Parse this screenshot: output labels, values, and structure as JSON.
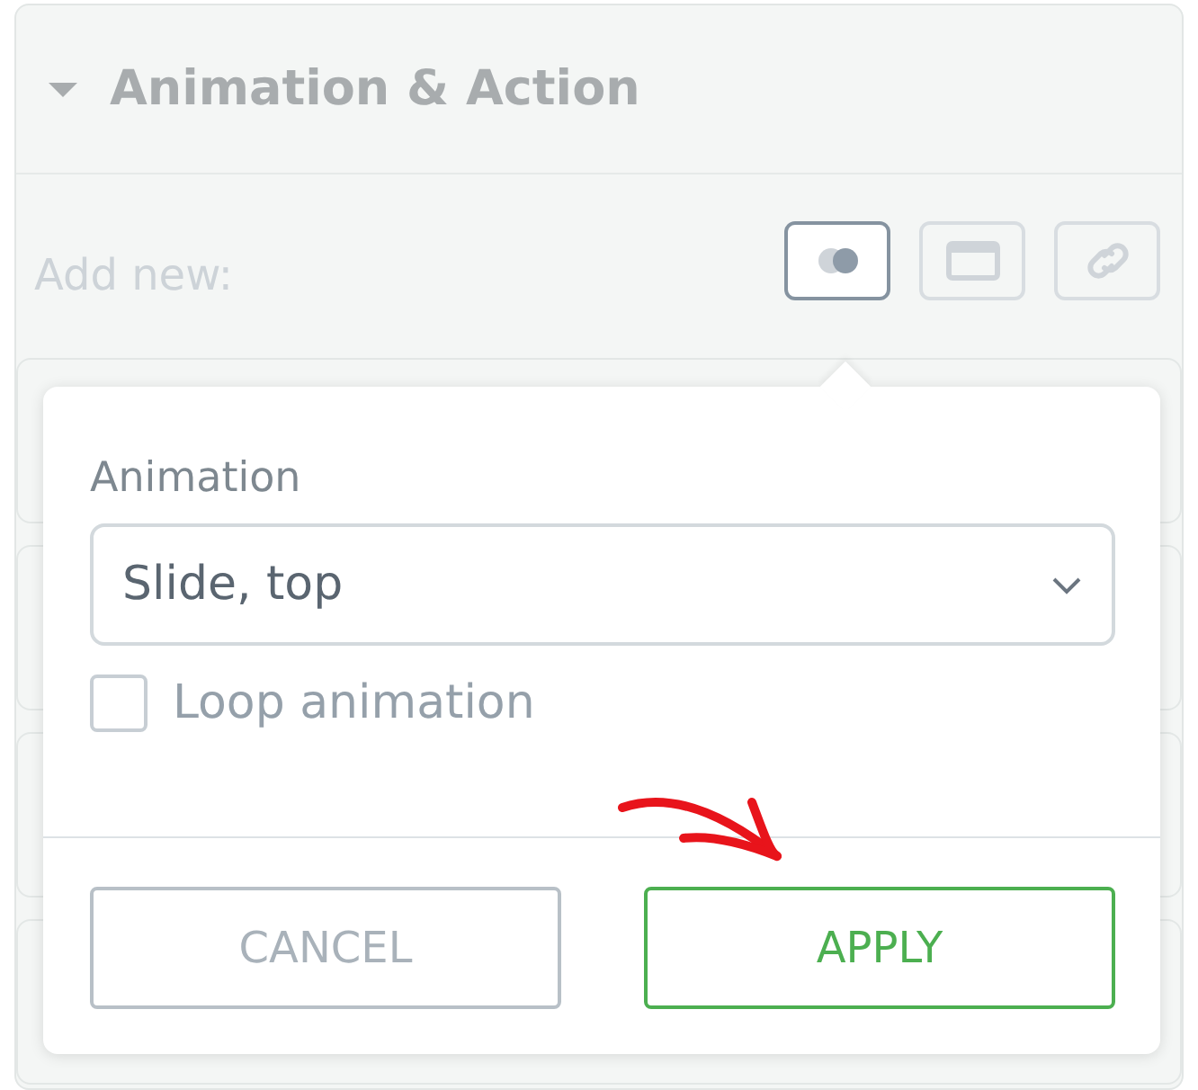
{
  "section": {
    "title": "Animation & Action",
    "expanded": true
  },
  "add_new": {
    "label": "Add new:",
    "buttons": [
      {
        "kind": "animation",
        "selected": true
      },
      {
        "kind": "popup",
        "selected": false
      },
      {
        "kind": "link",
        "selected": false
      }
    ]
  },
  "popover": {
    "field_label": "Animation",
    "select_value": "Slide, top",
    "loop": {
      "label": "Loop animation",
      "checked": false
    },
    "buttons": [
      {
        "label": "CANCEL",
        "kind": "secondary"
      },
      {
        "label": "APPLY",
        "kind": "primary"
      }
    ]
  }
}
